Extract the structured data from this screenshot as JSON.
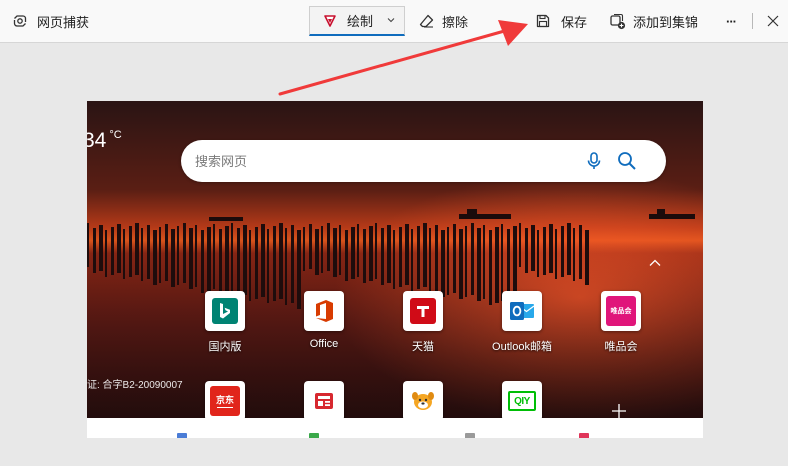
{
  "toolbar": {
    "title": "网页捕获",
    "draw_label": "绘制",
    "erase_label": "擦除",
    "save_label": "保存",
    "collect_label": "添加到集锦",
    "more_label": "···"
  },
  "capture": {
    "weather_temp": "34",
    "weather_unit": "°C",
    "search_placeholder": "搜索网页",
    "license_text": "证: 合字B2-20090007",
    "tiles_row1": [
      {
        "label": "国内版",
        "icon": "bing-icon",
        "color": "#008373"
      },
      {
        "label": "Office",
        "icon": "office-icon",
        "color": "#d83b01"
      },
      {
        "label": "天猫",
        "icon": "tmall-icon",
        "color": "#d00b17"
      },
      {
        "label": "Outlook邮箱",
        "icon": "outlook-icon",
        "color": "#0f6cbd"
      },
      {
        "label": "唯品会",
        "icon": "vip-icon",
        "color": "#e0157a"
      }
    ],
    "tiles_row2": [
      {
        "label": "",
        "icon": "jd-icon",
        "color": "#e1251b",
        "logo_text": "京东"
      },
      {
        "label": "",
        "icon": "news-icon",
        "color": "#d7282f"
      },
      {
        "label": "",
        "icon": "dog-icon",
        "color": "#f5a623"
      },
      {
        "label": "",
        "icon": "iqiyi-icon",
        "color": "#00be06",
        "logo_text": "QIY"
      }
    ]
  },
  "colors": {
    "accent": "#0f6cbd",
    "annotation_arrow": "#f03a3a"
  }
}
